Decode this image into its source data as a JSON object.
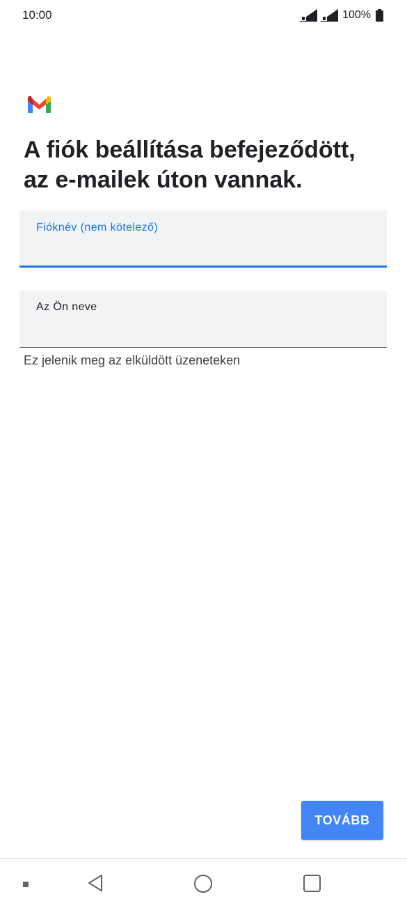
{
  "status_bar": {
    "time": "10:00",
    "battery_percent": "100%",
    "signal_icons": [
      "signal-sim1-icon",
      "signal-sim2-icon"
    ],
    "battery_icon": "battery-icon"
  },
  "logo": {
    "icon": "gmail-logo-icon"
  },
  "title": {
    "line1": "A fiók beállítása befejeződött,",
    "line2": "az e-mailek úton vannak."
  },
  "fields": {
    "account_name": {
      "label": "Fióknév (nem kötelező)",
      "value": "",
      "focused": true
    },
    "your_name": {
      "label": "Az Ön neve",
      "value": "",
      "helper": "Ez jelenik meg az elküldött üzeneteken"
    }
  },
  "actions": {
    "next_label": "TOVÁBB"
  },
  "nav_bar": {
    "icons": [
      "menu-dot-icon",
      "back-icon",
      "home-icon",
      "recents-icon"
    ]
  },
  "colors": {
    "accent": "#1a73e8",
    "button": "#4285f4",
    "field_background": "#f1f3f4",
    "text": "#202124"
  }
}
